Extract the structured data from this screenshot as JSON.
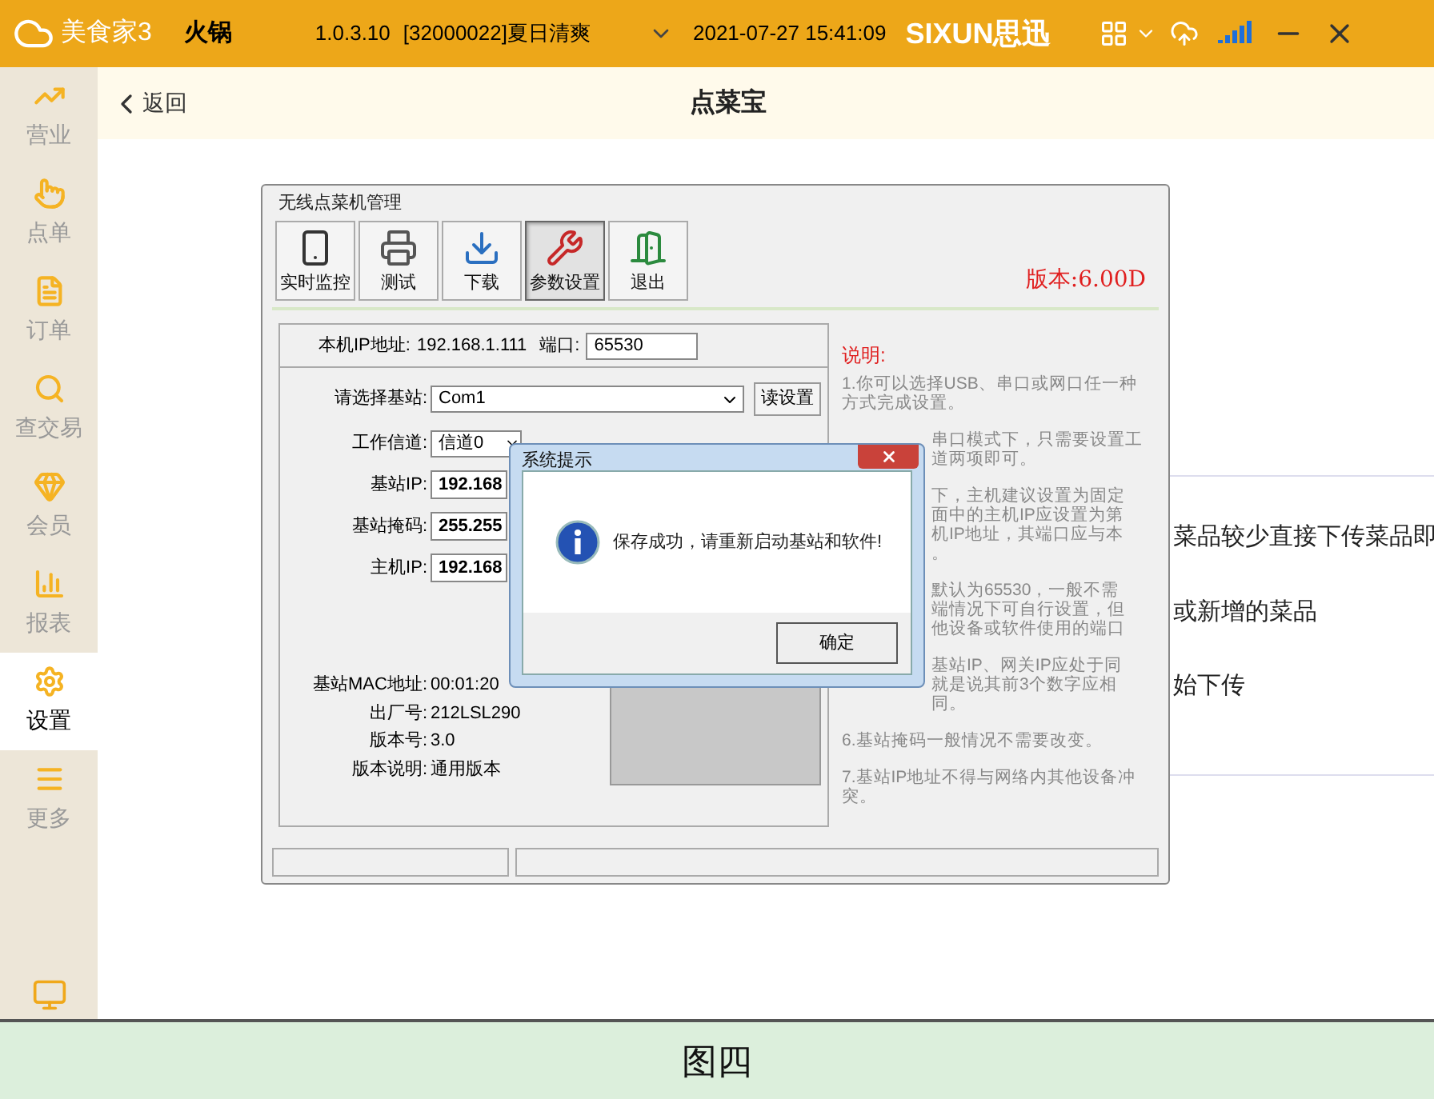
{
  "app": {
    "logo": "美食家3",
    "store": "火锅",
    "version": "1.0.3.10",
    "account": "[32000022]夏日清爽",
    "datetime": "2021-07-27 15:41:09",
    "brand": "SIXUN思迅"
  },
  "sidebar": {
    "items": [
      {
        "label": "营业",
        "selected": false
      },
      {
        "label": "点单",
        "selected": false
      },
      {
        "label": "订单",
        "selected": false
      },
      {
        "label": "查交易",
        "selected": false
      },
      {
        "label": "会员",
        "selected": false
      },
      {
        "label": "报表",
        "selected": false
      },
      {
        "label": "设置",
        "selected": true
      },
      {
        "label": "更多",
        "selected": false
      }
    ]
  },
  "header": {
    "back": "返回",
    "title": "点菜宝"
  },
  "background_lines": [
    "菜品较少直接下传菜品即",
    "或新增的菜品",
    "始下传"
  ],
  "inner_window": {
    "title": "无线点菜机管理",
    "toolbar": [
      {
        "label": "实时监控",
        "selected": false
      },
      {
        "label": "测试",
        "selected": false
      },
      {
        "label": "下载",
        "selected": false
      },
      {
        "label": "参数设置",
        "selected": true
      },
      {
        "label": "退出",
        "selected": false
      }
    ],
    "version": "版本:6.00D",
    "local_ip_label": "本机IP地址:",
    "local_ip": "192.168.1.111",
    "port_label": "端口:",
    "port": "65530",
    "base_label": "请选择基站:",
    "base": "Com1",
    "read_button": "读设置",
    "fields": [
      {
        "label": "工作信道:",
        "value": "信道0",
        "kind": "select"
      },
      {
        "label": "基站IP:",
        "value": "192.168",
        "kind": "ip"
      },
      {
        "label": "基站掩码:",
        "value": "255.255",
        "kind": "ip"
      },
      {
        "label": "主机IP:",
        "value": "192.168",
        "kind": "ip"
      }
    ],
    "info": [
      {
        "label": "基站MAC地址:",
        "value": "00:01:20"
      },
      {
        "label": "出厂号:",
        "value": "212LSL290"
      },
      {
        "label": "版本号:",
        "value": "3.0"
      },
      {
        "label": "版本说明:",
        "value": "通用版本"
      }
    ],
    "notes_title": "说明:",
    "notes": [
      {
        "kind": "full",
        "lines": [
          "1.你可以选择USB、串口或网口任一种方式完成设置。"
        ]
      },
      {
        "kind": "partial",
        "lines": [
          "串口模式下，只需要设置工",
          "道两项即可。"
        ]
      },
      {
        "kind": "partial",
        "lines": [
          "下，主机建议设置为固定",
          "面中的主机IP应设置为第",
          "机IP地址，其端口应与本",
          "。"
        ]
      },
      {
        "kind": "partial",
        "lines": [
          "默认为65530，一般不需",
          "端情况下可自行设置，但",
          "他设备或软件使用的端口"
        ]
      },
      {
        "kind": "partial",
        "lines": [
          "基站IP、网关IP应处于同",
          "就是说其前3个数字应相同。"
        ]
      },
      {
        "kind": "full",
        "lines": [
          "6.基站掩码一般情况不需要改变。"
        ]
      },
      {
        "kind": "full",
        "lines": [
          "7.基站IP地址不得与网络内其他设备冲突。"
        ]
      }
    ]
  },
  "dialog": {
    "title": "系统提示",
    "message": "保存成功，请重新启动基站和软件!",
    "ok": "确定"
  },
  "caption": "图四"
}
